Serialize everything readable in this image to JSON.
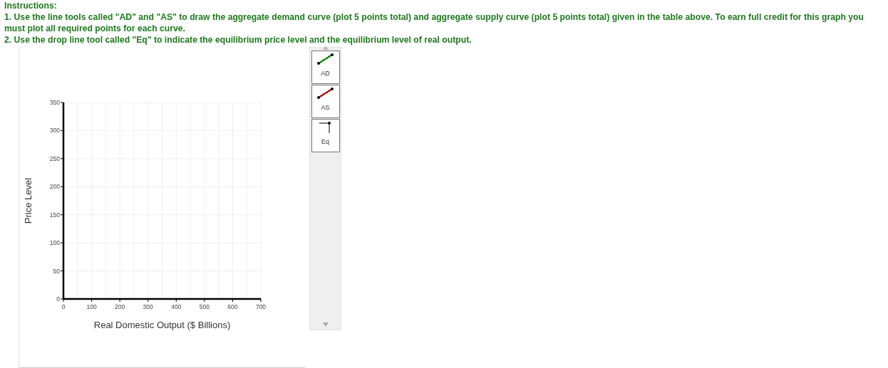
{
  "instructions": {
    "heading": "Instructions:",
    "lines": [
      "1. Use the line tools called \"AD\" and \"AS\" to draw the aggregate demand curve (plot 5 points total) and aggregate supply curve (plot 5 points total) given in the table above. To earn full credit for this graph you must plot all required points for each curve.",
      "2. Use the drop line tool called \"Eq\" to indicate the equilibrium price level and the equilibrium level of real output."
    ]
  },
  "graph": {
    "chart_data": {
      "type": "line",
      "grid": true,
      "xlabel": "Real Domestic Output ($ Billions)",
      "ylabel": "Price Level",
      "xlim": [
        0,
        700
      ],
      "ylim": [
        0,
        350
      ],
      "xticks": [
        0,
        100,
        200,
        300,
        400,
        500,
        600,
        700
      ],
      "yticks": [
        0,
        50,
        100,
        150,
        200,
        250,
        300,
        350
      ]
    }
  },
  "tools": [
    {
      "label": "AD",
      "kind": "line",
      "color": "#1a8a1a"
    },
    {
      "label": "AS",
      "kind": "line",
      "color": "#b01c1c"
    },
    {
      "label": "Eq",
      "kind": "drop"
    }
  ]
}
